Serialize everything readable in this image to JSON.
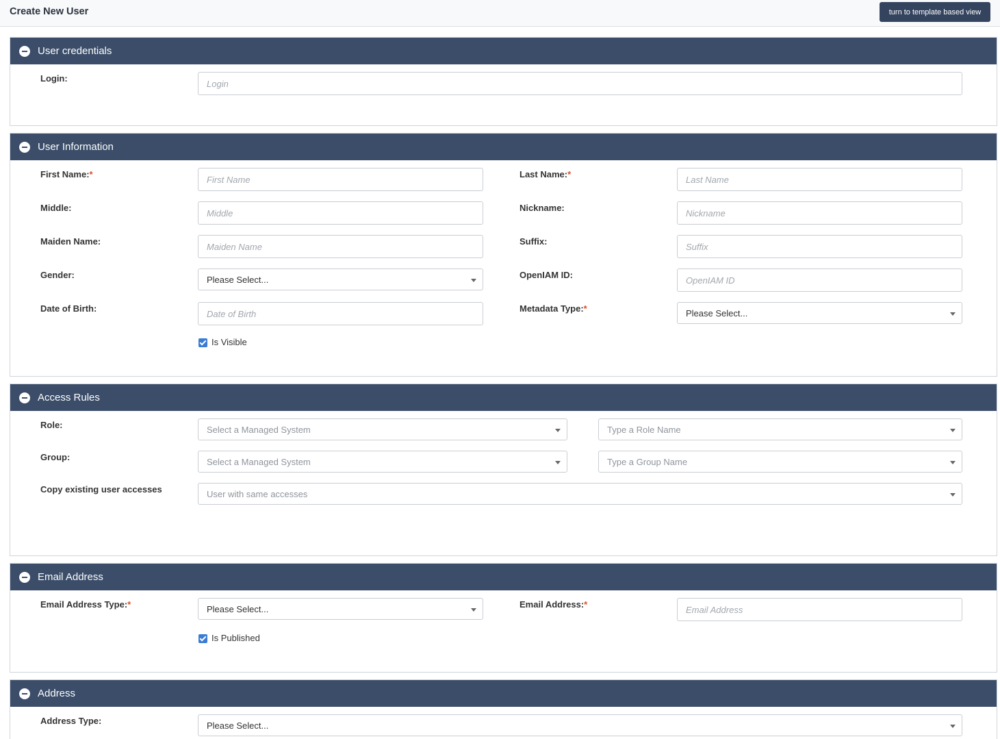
{
  "page": {
    "title": "Create New User",
    "template_button": "turn to template based view"
  },
  "credentials": {
    "header": "User credentials",
    "login_label": "Login:",
    "login_placeholder": "Login"
  },
  "user_info": {
    "header": "User Information",
    "required_mark": "*",
    "first_name_label": "First Name:",
    "first_name_placeholder": "First Name",
    "last_name_label": "Last Name:",
    "last_name_placeholder": "Last Name",
    "middle_label": "Middle:",
    "middle_placeholder": "Middle",
    "nickname_label": "Nickname:",
    "nickname_placeholder": "Nickname",
    "maiden_label": "Maiden Name:",
    "maiden_placeholder": "Maiden Name",
    "suffix_label": "Suffix:",
    "suffix_placeholder": "Suffix",
    "gender_label": "Gender:",
    "gender_value": "Please Select...",
    "openiam_label": "OpenIAM ID:",
    "openiam_placeholder": "OpenIAM ID",
    "dob_label": "Date of Birth:",
    "dob_placeholder": "Date of Birth",
    "metadata_label": "Metadata Type:",
    "metadata_value": "Please Select...",
    "is_visible_label": "Is Visible",
    "is_visible_checked": true
  },
  "access_rules": {
    "header": "Access Rules",
    "role_label": "Role:",
    "role_system_placeholder": "Select a Managed System",
    "role_name_placeholder": "Type a Role Name",
    "group_label": "Group:",
    "group_system_placeholder": "Select a Managed System",
    "group_name_placeholder": "Type a Group Name",
    "copy_label": "Copy existing user accesses",
    "copy_placeholder": "User with same accesses"
  },
  "email": {
    "header": "Email Address",
    "type_label": "Email Address Type:",
    "type_value": "Please Select...",
    "address_label": "Email Address:",
    "address_placeholder": "Email Address",
    "is_published_label": "Is Published",
    "is_published_checked": true
  },
  "address": {
    "header": "Address",
    "type_label": "Address Type:",
    "type_value": "Please Select..."
  },
  "colors": {
    "header_bg": "#3b4d69",
    "button_bg": "#34445f",
    "required": "#d8502a",
    "checkbox": "#3a7bd5"
  }
}
